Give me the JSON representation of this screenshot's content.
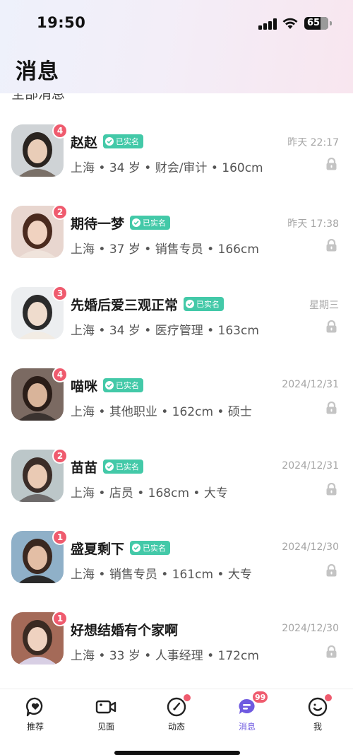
{
  "status_bar": {
    "time": "19:50",
    "battery": "65"
  },
  "header": {
    "title": "消息"
  },
  "section_peek": "全部消息",
  "verified_label": "已实名",
  "conversations": [
    {
      "name": "赵赵",
      "verified": true,
      "time": "昨天 22:17",
      "info": "上海 • 34 岁 • 财会/审计 • 160cm",
      "unread": "4"
    },
    {
      "name": "期待一梦",
      "verified": true,
      "time": "昨天 17:38",
      "info": "上海 • 37 岁 • 销售专员 • 166cm",
      "unread": "2"
    },
    {
      "name": "先婚后爱三观正常",
      "verified": true,
      "time": "星期三",
      "info": "上海 • 34 岁 • 医疗管理 • 163cm",
      "unread": "3"
    },
    {
      "name": "喵咪",
      "verified": true,
      "time": "2024/12/31",
      "info": "上海 • 其他职业 • 162cm • 硕士",
      "unread": "4"
    },
    {
      "name": "苗苗",
      "verified": true,
      "time": "2024/12/31",
      "info": "上海 • 店员 • 168cm • 大专",
      "unread": "2"
    },
    {
      "name": "盛夏剩下",
      "verified": true,
      "time": "2024/12/30",
      "info": "上海 • 销售专员 • 161cm • 大专",
      "unread": "1"
    },
    {
      "name": "好想结婚有个家啊",
      "verified": false,
      "time": "2024/12/30",
      "info": "上海 • 33 岁 • 人事经理 • 172cm",
      "unread": "1"
    }
  ],
  "tabbar": [
    {
      "label": "推荐",
      "icon": "chat-heart-icon"
    },
    {
      "label": "见面",
      "icon": "video-camera-icon"
    },
    {
      "label": "动态",
      "icon": "compass-icon"
    },
    {
      "label": "消息",
      "icon": "message-icon",
      "count": "99",
      "active": true
    },
    {
      "label": "我",
      "icon": "smile-icon"
    }
  ],
  "colors": {
    "accent": "#6f5ae0",
    "badge": "#ef5b6e",
    "verified": "#43c9a8"
  }
}
